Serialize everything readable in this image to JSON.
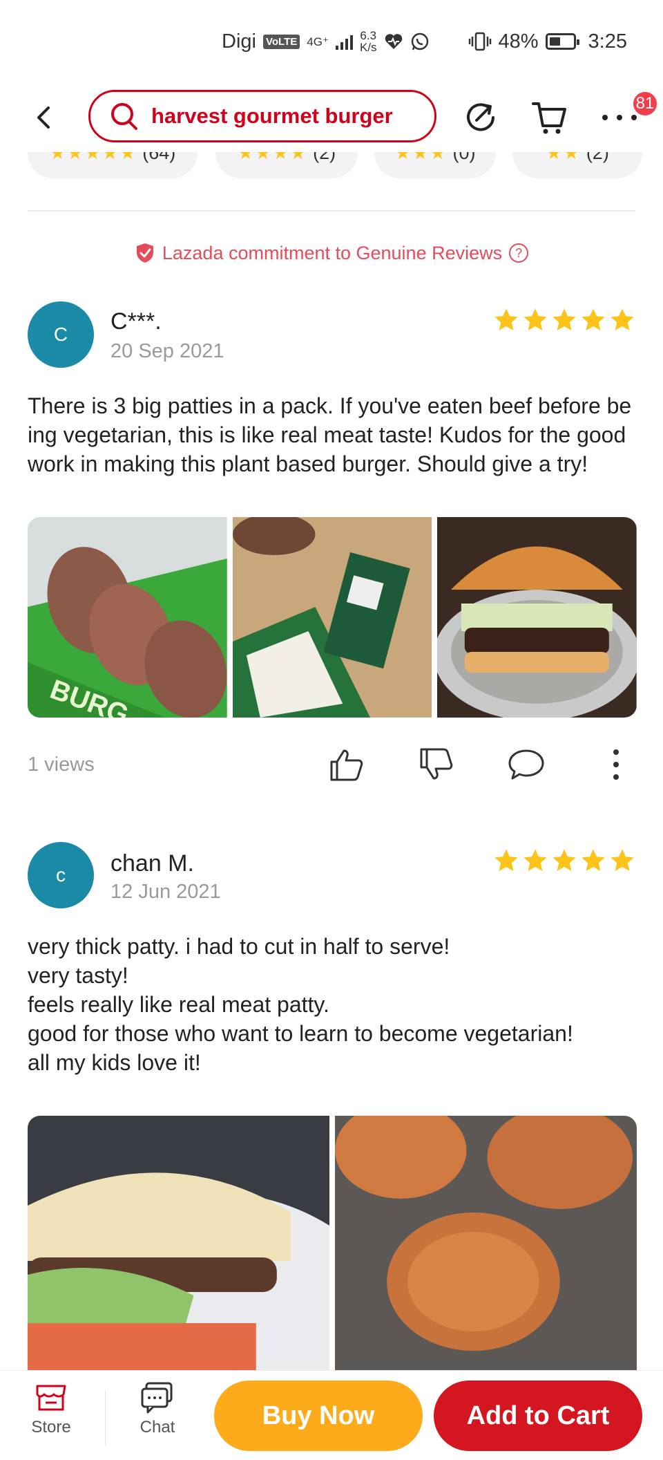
{
  "status_bar": {
    "carrier": "Digi",
    "volte": "VoLTE",
    "network": "4G⁺",
    "speed_value": "6.3",
    "speed_unit": "K/s",
    "battery": "48%",
    "time": "3:25"
  },
  "nav": {
    "search_value": "harvest gourmet burger",
    "cart_badge": "81"
  },
  "filters": [
    {
      "stars": "★★★★★",
      "count": "(64)"
    },
    {
      "stars": "★★★★",
      "count": "(2)"
    },
    {
      "stars": "★★★",
      "count": "(0)"
    },
    {
      "stars": "★★",
      "count": "(2)"
    }
  ],
  "commitment": {
    "text": "Lazada commitment to Genuine Reviews",
    "help": "?"
  },
  "reviews": [
    {
      "avatar_letter": "C",
      "name": "C***.",
      "date": "20 Sep 2021",
      "rating": 5,
      "text": "There is 3 big patties in a pack. If you've eaten beef before being vegetarian, this is like real meat taste! Kudos for the good work in making this plant based burger. Should give a try!",
      "views": "1 views"
    },
    {
      "avatar_letter": "c",
      "name": "chan M.",
      "date": "12 Jun 2021",
      "rating": 5,
      "text": "very thick patty. i had to cut in half to serve!\nvery tasty!\nfeels really like real meat patty.\ngood for those who want to learn to become vegetarian!\nall my kids love it!"
    }
  ],
  "bottom_bar": {
    "store_label": "Store",
    "chat_label": "Chat",
    "buy_now": "Buy Now",
    "add_to_cart": "Add to Cart"
  },
  "colors": {
    "accent_red": "#d0021b",
    "star_yellow": "#fcc419",
    "buy_orange": "#fdab1b",
    "cart_red": "#d3161f",
    "avatar_teal": "#1a8aa6"
  }
}
